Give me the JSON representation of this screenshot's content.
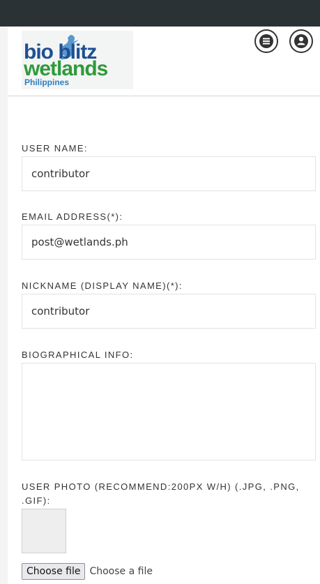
{
  "logo": {
    "line1": "bio blitz",
    "line2": "wetlands",
    "line3": "Philippines"
  },
  "header": {
    "menu_icon": "hamburger-menu-icon",
    "user_icon": "user-avatar-icon"
  },
  "form": {
    "username": {
      "label": "USER NAME:",
      "value": "contributor"
    },
    "email": {
      "label": "EMAIL ADDRESS(*):",
      "value": "post@wetlands.ph"
    },
    "nickname": {
      "label": "NICKNAME (DISPLAY NAME)(*):",
      "value": "contributor"
    },
    "bio": {
      "label": "BIOGRAPHICAL INFO:",
      "value": ""
    },
    "photo": {
      "label": "USER PHOTO (RECOMMEND:200PX W/H) (.JPG, .PNG, .GIF):",
      "button_label": "Choose file",
      "file_status": "Choose a file"
    }
  },
  "colors": {
    "topbar": "#2b3236",
    "logo_blue": "#1f4f93",
    "logo_green": "#2f9a3a"
  }
}
